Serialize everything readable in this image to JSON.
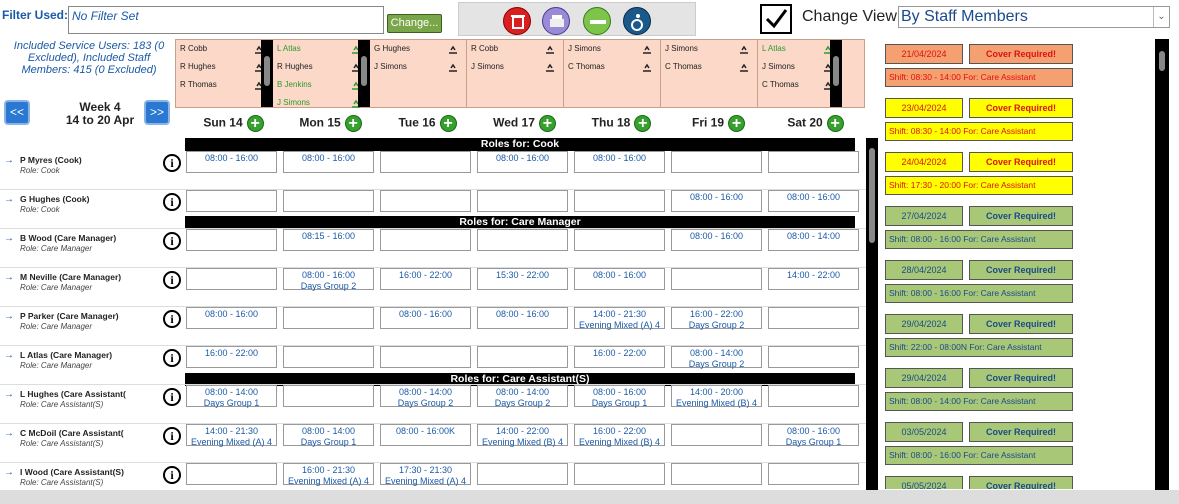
{
  "filter": {
    "label": "Filter Used:",
    "value": "No Filter Set",
    "change_label": "Change..."
  },
  "toolbar": {
    "icons": [
      "delete-icon",
      "print-icon",
      "bed-icon",
      "wheelchair-icon"
    ]
  },
  "change_view": {
    "label": "Change View:",
    "selected": "By Staff Members"
  },
  "included_text": "Included Service Users: 183 (0 Excluded), Included Staff Members: 415 (0 Excluded)",
  "week": {
    "title": "Week 4",
    "range": "14 to 20 Apr",
    "prev": "<<",
    "next": ">>"
  },
  "days": [
    "Sun 14",
    "Mon 15",
    "Tue 16",
    "Wed 17",
    "Thu 18",
    "Fri 19",
    "Sat 20"
  ],
  "summary": [
    [
      {
        "n": "R Cobb",
        "g": false
      },
      {
        "n": "R Hughes",
        "g": false
      },
      {
        "n": "R Thomas",
        "g": false
      }
    ],
    [
      {
        "n": "L Atlas",
        "g": true
      },
      {
        "n": "R Hughes",
        "g": false
      },
      {
        "n": "B Jenkins",
        "g": true
      },
      {
        "n": "J Simons",
        "g": true
      }
    ],
    [
      {
        "n": "G Hughes",
        "g": false
      },
      {
        "n": "J Simons",
        "g": false
      }
    ],
    [
      {
        "n": "R Cobb",
        "g": false
      },
      {
        "n": "J Simons",
        "g": false
      }
    ],
    [
      {
        "n": "J Simons",
        "g": false
      },
      {
        "n": "C Thomas",
        "g": false
      }
    ],
    [
      {
        "n": "J Simons",
        "g": false
      },
      {
        "n": "C Thomas",
        "g": false
      }
    ],
    [
      {
        "n": "L Atlas",
        "g": true
      },
      {
        "n": "J Simons",
        "g": false
      },
      {
        "n": "C Thomas",
        "g": false
      }
    ]
  ],
  "role_headers": [
    "Roles for: Cook",
    "Roles for: Care Manager",
    "Roles for: Care Assistant(S)"
  ],
  "staff": [
    {
      "name": "P Myres (Cook)",
      "role": "Role: Cook",
      "cells": [
        [
          "08:00 - 16:00",
          ""
        ],
        [
          "08:00 - 16:00",
          ""
        ],
        [
          "",
          ""
        ],
        [
          "08:00 - 16:00",
          ""
        ],
        [
          "08:00 - 16:00",
          ""
        ],
        [
          "",
          ""
        ],
        [
          "",
          ""
        ]
      ]
    },
    {
      "name": "G Hughes (Cook)",
      "role": "Role: Cook",
      "cells": [
        [
          "",
          ""
        ],
        [
          "",
          ""
        ],
        [
          "",
          ""
        ],
        [
          "",
          ""
        ],
        [
          "",
          ""
        ],
        [
          "08:00 - 16:00",
          ""
        ],
        [
          "08:00 - 16:00",
          ""
        ]
      ]
    },
    {
      "name": "B Wood (Care Manager)",
      "role": "Role: Care Manager",
      "cells": [
        [
          "",
          ""
        ],
        [
          "08:15 - 16:00",
          ""
        ],
        [
          "",
          ""
        ],
        [
          "",
          ""
        ],
        [
          "",
          ""
        ],
        [
          "08:00 - 16:00",
          ""
        ],
        [
          "08:00 - 14:00",
          ""
        ]
      ]
    },
    {
      "name": "M Neville (Care Manager)",
      "role": "Role: Care Manager",
      "cells": [
        [
          "",
          ""
        ],
        [
          "08:00 - 16:00",
          "Days Group 2"
        ],
        [
          "16:00 - 22:00",
          ""
        ],
        [
          "15:30 - 22:00",
          ""
        ],
        [
          "08:00 - 16:00",
          ""
        ],
        [
          "",
          ""
        ],
        [
          "14:00 - 22:00",
          ""
        ]
      ]
    },
    {
      "name": "P Parker (Care Manager)",
      "role": "Role: Care Manager",
      "cells": [
        [
          "08:00 - 16:00",
          ""
        ],
        [
          "",
          ""
        ],
        [
          "08:00 - 16:00",
          ""
        ],
        [
          "08:00 - 16:00",
          ""
        ],
        [
          "14:00 - 21:30",
          "Evening Mixed (A) 4"
        ],
        [
          "16:00 - 22:00",
          "Days Group 2"
        ],
        [
          "",
          ""
        ]
      ]
    },
    {
      "name": "L Atlas (Care Manager)",
      "role": "Role: Care Manager",
      "cells": [
        [
          "16:00 - 22:00",
          ""
        ],
        [
          "",
          ""
        ],
        [
          "",
          ""
        ],
        [
          "",
          ""
        ],
        [
          "16:00 - 22:00",
          ""
        ],
        [
          "08:00 - 14:00",
          "Days Group 2"
        ],
        [
          "",
          ""
        ]
      ]
    },
    {
      "name": "L Hughes (Care Assistant(",
      "role": "Role: Care Assistant(S)",
      "cells": [
        [
          "08:00 - 14:00",
          "Days Group 1"
        ],
        [
          "",
          ""
        ],
        [
          "08:00 - 14:00",
          "Days Group 2"
        ],
        [
          "08:00 - 14:00",
          "Days Group 2"
        ],
        [
          "08:00 - 16:00",
          "Days Group 1"
        ],
        [
          "14:00 - 20:00",
          "Evening Mixed (B) 4"
        ],
        [
          "",
          ""
        ]
      ]
    },
    {
      "name": "C McDoil (Care Assistant(",
      "role": "Role: Care Assistant(S)",
      "cells": [
        [
          "14:00 - 21:30",
          "Evening Mixed (A) 4"
        ],
        [
          "08:00 - 14:00",
          "Days Group 1"
        ],
        [
          "08:00 - 16:00K",
          ""
        ],
        [
          "14:00 - 22:00",
          "Evening Mixed (B) 4"
        ],
        [
          "16:00 - 22:00",
          "Evening Mixed (B) 4"
        ],
        [
          "",
          ""
        ],
        [
          "08:00 - 16:00",
          "Days Group 1"
        ]
      ]
    },
    {
      "name": "I Wood (Care Assistant(S)",
      "role": "Role: Care Assistant(S)",
      "cells": [
        [
          "",
          ""
        ],
        [
          "16:00 - 21:30",
          "Evening Mixed (A) 4"
        ],
        [
          "17:30 - 21:30",
          "Evening Mixed (A) 4"
        ],
        [
          "",
          ""
        ],
        [
          "",
          ""
        ],
        [
          "",
          ""
        ],
        [
          "",
          ""
        ]
      ]
    }
  ],
  "covers": [
    {
      "date": "21/04/2024",
      "status": "Cover Required!",
      "shift": "Shift: 08:30 - 14:00 For: Care Assistant",
      "color": "#f4a070",
      "text": "#e01010"
    },
    {
      "date": "23/04/2024",
      "status": "Cover Required!",
      "shift": "Shift: 08:30 - 14:00 For: Care Assistant",
      "color": "#ffff00",
      "text": "#e01010"
    },
    {
      "date": "24/04/2024",
      "status": "Cover Required!",
      "shift": "Shift: 17:30 - 20:00 For: Care Assistant",
      "color": "#ffff00",
      "text": "#e01010"
    },
    {
      "date": "27/04/2024",
      "status": "Cover Required!",
      "shift": "Shift: 08:00 - 16:00 For: Care Assistant",
      "color": "#a8c878",
      "text": "#1a4a8a"
    },
    {
      "date": "28/04/2024",
      "status": "Cover Required!",
      "shift": "Shift: 08:00 - 16:00 For: Care Assistant",
      "color": "#a8c878",
      "text": "#1a4a8a"
    },
    {
      "date": "29/04/2024",
      "status": "Cover Required!",
      "shift": "Shift: 22:00 - 08:00N For: Care Assistant",
      "color": "#a8c878",
      "text": "#1a4a8a"
    },
    {
      "date": "29/04/2024",
      "status": "Cover Required!",
      "shift": "Shift: 08:00 - 14:00 For: Care Assistant",
      "color": "#a8c878",
      "text": "#1a4a8a"
    },
    {
      "date": "03/05/2024",
      "status": "Cover Required!",
      "shift": "Shift: 08:00 - 16:00 For: Care Assistant",
      "color": "#a8c878",
      "text": "#1a4a8a"
    },
    {
      "date": "05/05/2024",
      "status": "Cover Required!",
      "shift": "",
      "color": "#a8c878",
      "text": "#1a4a8a"
    }
  ]
}
